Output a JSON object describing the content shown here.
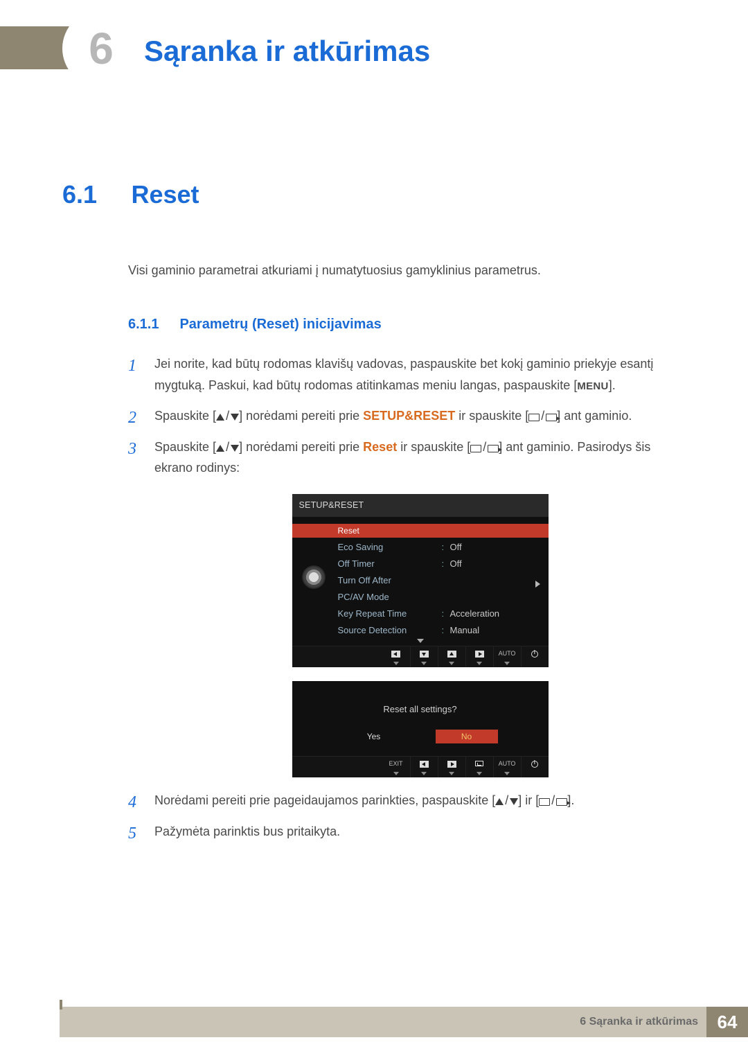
{
  "header": {
    "chapter_number": "6",
    "chapter_title": "Sąranka ir atkūrimas"
  },
  "section": {
    "number": "6.1",
    "title": "Reset",
    "intro": "Visi gaminio parametrai atkuriami į numatytuosius gamyklinius parametrus."
  },
  "subsection": {
    "number": "6.1.1",
    "title": "Parametrų (Reset) inicijavimas"
  },
  "steps": {
    "s1a": "Jei norite, kad būtų rodomas klavišų vadovas, paspauskite bet kokį gaminio priekyje esantį mygtuką. Paskui, kad būtų rodomas atitinkamas meniu langas, paspauskite [",
    "s1_menu": "MENU",
    "s1b": "].",
    "s2a": "Spauskite [",
    "s2b": "] norėdami pereiti prie ",
    "s2_kw": "SETUP&RESET",
    "s2c": " ir spauskite [",
    "s2d": "] ant gaminio.",
    "s3a": "Spauskite [",
    "s3b": "] norėdami pereiti prie ",
    "s3_kw": "Reset",
    "s3c": " ir spauskite [",
    "s3d": "] ant gaminio. Pasirodys šis ekrano rodinys:",
    "s4a": "Norėdami pereiti prie pageidaujamos parinkties, paspauskite [",
    "s4b": "] ir [",
    "s4c": "].",
    "s5": "Pažymėta parinktis bus pritaikyta."
  },
  "osd1": {
    "title": "SETUP&RESET",
    "items": [
      {
        "label": "Reset",
        "value": ""
      },
      {
        "label": "Eco Saving",
        "value": "Off"
      },
      {
        "label": "Off Timer",
        "value": "Off"
      },
      {
        "label": "Turn Off After",
        "value": ""
      },
      {
        "label": "PC/AV Mode",
        "value": ""
      },
      {
        "label": "Key Repeat Time",
        "value": "Acceleration"
      },
      {
        "label": "Source Detection",
        "value": "Manual"
      }
    ],
    "btnbar": {
      "auto": "AUTO"
    }
  },
  "osd2": {
    "question": "Reset all settings?",
    "yes": "Yes",
    "no": "No",
    "btnbar": {
      "exit": "EXIT",
      "auto": "AUTO"
    }
  },
  "footer": {
    "chapter": "6 Sąranka ir atkūrimas",
    "page": "64"
  }
}
